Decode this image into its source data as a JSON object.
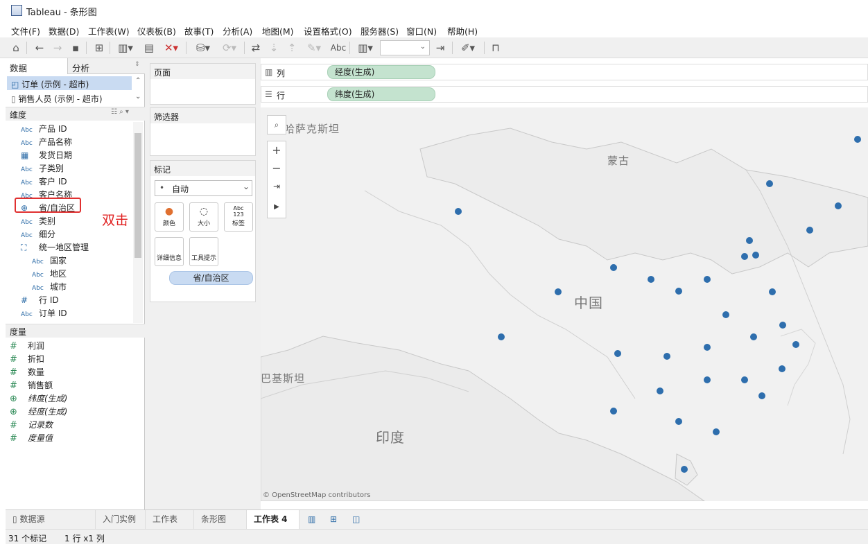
{
  "window": {
    "title": "Tableau - 条形图"
  },
  "menu": [
    "文件(F)",
    "数据(D)",
    "工作表(W)",
    "仪表板(B)",
    "故事(T)",
    "分析(A)",
    "地图(M)",
    "设置格式(O)",
    "服务器(S)",
    "窗口(N)",
    "帮助(H)"
  ],
  "toolbar": {
    "abc_label": "Abc"
  },
  "left": {
    "tab_data": "数据",
    "tab_analysis": "分析",
    "datasources": [
      "订单 (示例 - 超市)",
      "销售人员 (示例 - 超市)"
    ],
    "dimensions_header": "维度",
    "dimensions": [
      {
        "type": "Abc",
        "name": "产品 ID"
      },
      {
        "type": "Abc",
        "name": "产品名称"
      },
      {
        "type": "date",
        "name": "发货日期"
      },
      {
        "type": "Abc",
        "name": "子类别"
      },
      {
        "type": "Abc",
        "name": "客户 ID"
      },
      {
        "type": "Abc",
        "name": "客户名称"
      },
      {
        "type": "geo",
        "name": "省/自治区"
      },
      {
        "type": "Abc",
        "name": "类别"
      },
      {
        "type": "Abc",
        "name": "细分"
      },
      {
        "type": "hier",
        "name": "统一地区管理"
      },
      {
        "type": "Abc",
        "name": "国家"
      },
      {
        "type": "Abc",
        "name": "地区"
      },
      {
        "type": "Abc",
        "name": "城市"
      },
      {
        "type": "#",
        "name": "行 ID"
      },
      {
        "type": "Abc",
        "name": "订单 ID"
      }
    ],
    "measures_header": "度量",
    "measures": [
      {
        "type": "#",
        "name": "利润"
      },
      {
        "type": "#",
        "name": "折扣"
      },
      {
        "type": "#",
        "name": "数量"
      },
      {
        "type": "#",
        "name": "销售额"
      },
      {
        "type": "geo",
        "name": "纬度(生成)"
      },
      {
        "type": "geo",
        "name": "经度(生成)"
      },
      {
        "type": "#",
        "name": "记录数"
      },
      {
        "type": "#",
        "name": "度量值"
      }
    ],
    "annotation": "双击"
  },
  "shelves": {
    "pages": "页面",
    "filters": "筛选器",
    "marks": "标记",
    "mark_type": "自动",
    "mark_buttons": [
      "颜色",
      "大小",
      "标签",
      "详细信息",
      "工具提示"
    ],
    "label_glyph_1": "Abc",
    "label_glyph_2": "123",
    "detail_pill": "省/自治区",
    "columns_label": "列",
    "columns_pill": "经度(生成)",
    "rows_label": "行",
    "rows_pill": "纬度(生成)"
  },
  "map": {
    "labels": [
      "哈萨克斯坦",
      "蒙古",
      "中国",
      "巴基斯坦",
      "印度"
    ],
    "attribution": "© OpenStreetMap contributors",
    "mark_color": "#2e6ead",
    "mark_count_shown": 31
  },
  "bottom_tabs": [
    "数据源",
    "入门实例",
    "工作表",
    "条形图",
    "工作表 4"
  ],
  "status": {
    "marks": "31 个标记",
    "dims": "1 行 x1 列"
  }
}
